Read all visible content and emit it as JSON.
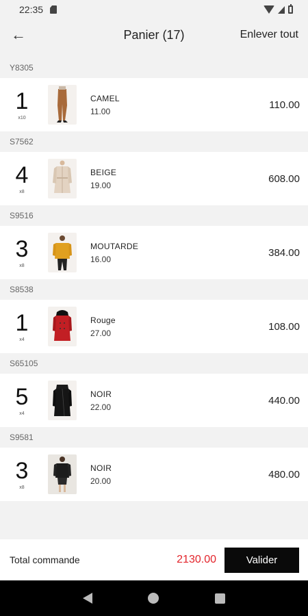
{
  "status": {
    "time": "22:35"
  },
  "header": {
    "title": "Panier (17)",
    "remove_all": "Enlever tout"
  },
  "groups": [
    {
      "ref": "Y8305",
      "qty": "1",
      "qty_sub": "x10",
      "color": "CAMEL",
      "unit_price": "11.00",
      "total": "110.00",
      "thumb": "pants-icon"
    },
    {
      "ref": "S7562",
      "qty": "4",
      "qty_sub": "x8",
      "color": "BEIGE",
      "unit_price": "19.00",
      "total": "608.00",
      "thumb": "trench-coat-icon"
    },
    {
      "ref": "S9516",
      "qty": "3",
      "qty_sub": "x8",
      "color": "MOUTARDE",
      "unit_price": "16.00",
      "total": "384.00",
      "thumb": "jacket-icon"
    },
    {
      "ref": "S8538",
      "qty": "1",
      "qty_sub": "x4",
      "color": "Rouge",
      "unit_price": "27.00",
      "total": "108.00",
      "thumb": "coat-icon"
    },
    {
      "ref": "S65105",
      "qty": "5",
      "qty_sub": "x4",
      "color": "NOIR",
      "unit_price": "22.00",
      "total": "440.00",
      "thumb": "coat-icon"
    },
    {
      "ref": "S9581",
      "qty": "3",
      "qty_sub": "x8",
      "color": "NOIR",
      "unit_price": "20.00",
      "total": "480.00",
      "thumb": "jacket-icon"
    }
  ],
  "footer": {
    "total_label": "Total commande",
    "total_value": "2130.00",
    "validate_label": "Valider"
  },
  "colors": {
    "accent": "#e3242b",
    "button_bg": "#0a0a0a",
    "background": "#f2f2f2"
  },
  "icons": {
    "back": "arrow-left-icon",
    "nav_back": "triangle-back-icon",
    "nav_home": "circle-home-icon",
    "nav_recent": "square-recent-icon"
  }
}
